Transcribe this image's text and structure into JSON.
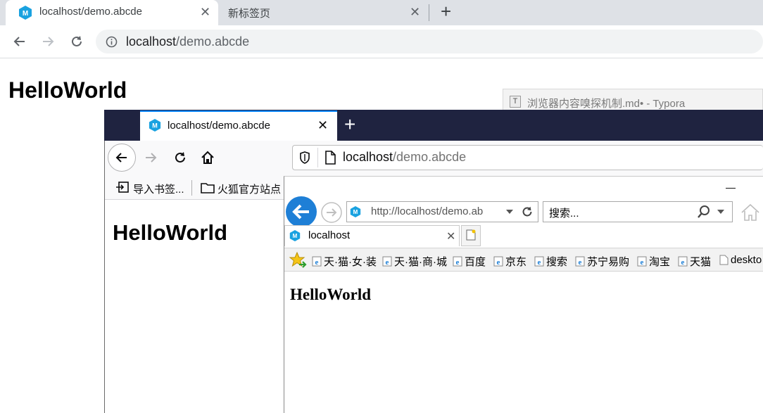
{
  "chrome": {
    "tabs": [
      {
        "title": "localhost/demo.abcde",
        "close": "✕"
      },
      {
        "title": "新标签页",
        "close": "✕"
      }
    ],
    "new_tab": "+",
    "url_host": "localhost",
    "url_rest": "/demo.abcde",
    "heading": "HelloWorld"
  },
  "typora": {
    "icon": "T",
    "title": "浏览器内容嗅探机制.md• - Typora"
  },
  "firefox": {
    "tab_title": "localhost/demo.abcde",
    "tab_close": "✕",
    "new_tab": "+",
    "url_host": "localhost",
    "url_rest": "/demo.abcde",
    "bookmarks": [
      "导入书签...",
      "火狐官方站点"
    ],
    "heading": "HelloWorld"
  },
  "ie": {
    "minimize": "—",
    "address": "http://localhost/demo.ab",
    "search_placeholder": "搜索...",
    "tab_title": "localhost",
    "tab_close": "✕",
    "favorites": [
      "天·猫·女·装",
      "天·猫·商·城",
      "百度",
      "京东",
      "搜索",
      "苏宁易购",
      "淘宝",
      "天猫",
      "deskto"
    ],
    "heading": "HelloWorld"
  },
  "colors": {
    "chrome_tabstrip": "#dee1e6",
    "firefox_tabbar": "#1f2340",
    "firefox_accent": "#0a84ff",
    "ie_blue": "#1e7fd6",
    "favicon": "#1aa2e0"
  }
}
